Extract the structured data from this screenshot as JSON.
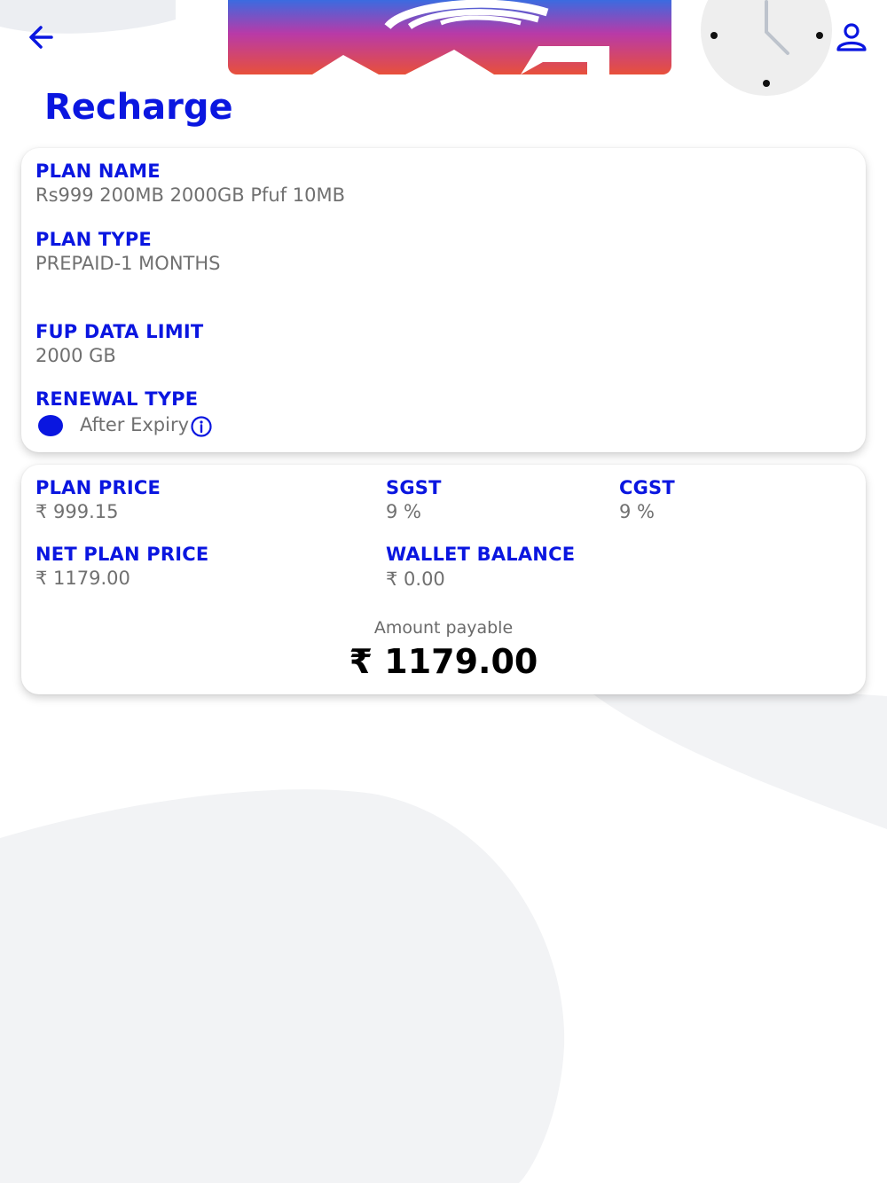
{
  "header": {
    "back_icon": "arrow-left-icon",
    "logo_icon": "brand-logo",
    "clock_icon": "clock-icon",
    "profile_icon": "user-icon"
  },
  "page_title": "Recharge",
  "plan_details": {
    "plan_name_label": "PLAN NAME",
    "plan_name_value": "Rs999 200MB 2000GB Pfuf 10MB",
    "plan_type_label": "PLAN TYPE",
    "plan_type_value": "PREPAID-1 MONTHS",
    "fup_label": "FUP DATA LIMIT",
    "fup_value": "2000 GB",
    "renewal_label": "RENEWAL TYPE",
    "renewal_option": "After Expiry",
    "renewal_selected": true
  },
  "pricing": {
    "plan_price_label": "PLAN PRICE",
    "plan_price_value": "₹ 999.15",
    "sgst_label": "SGST",
    "sgst_value": "9 %",
    "cgst_label": "CGST",
    "cgst_value": "9 %",
    "net_price_label": "NET PLAN PRICE",
    "net_price_value": "₹ 1179.00",
    "wallet_label": "WALLET BALANCE",
    "wallet_value": "₹ 0.00",
    "amount_payable_label": "Amount payable",
    "amount_payable_value": "₹ 1179.00"
  },
  "colors": {
    "accent": "#0a16e0",
    "muted_text": "#707070",
    "background_blob": "#f2f3f5"
  }
}
